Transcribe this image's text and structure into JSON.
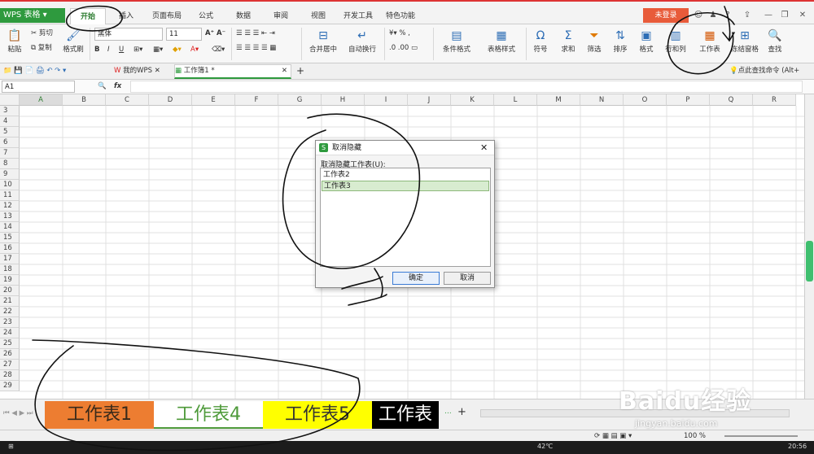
{
  "app": {
    "brand": "WPS 表格",
    "login_label": "未登录"
  },
  "tabs": [
    "开始",
    "插入",
    "页面布局",
    "公式",
    "数据",
    "审阅",
    "视图",
    "开发工具",
    "特色功能"
  ],
  "ribbon": {
    "paste": "粘贴",
    "cut": "剪切",
    "copy": "复制",
    "format_painter": "格式刷",
    "font_name": "黑体",
    "font_size": "11",
    "merge_center": "合并居中",
    "wrap_text": "自动换行",
    "percent": "%",
    "cond_format": "条件格式",
    "table_style": "表格样式",
    "symbol": "符号",
    "sum": "求和",
    "filter": "筛选",
    "sort": "排序",
    "format": "格式",
    "row_col": "行和列",
    "worksheet": "工作表",
    "freeze": "冻结窗格",
    "find": "查找"
  },
  "doc_tabs": [
    "我的WPS",
    "工作簿1 *"
  ],
  "search_command": "点此查找命令 (Alt+",
  "formula_bar": {
    "cell_ref": "A1",
    "fx": "fx"
  },
  "columns": [
    "A",
    "B",
    "C",
    "D",
    "E",
    "F",
    "G",
    "H",
    "I",
    "J",
    "K",
    "L",
    "M",
    "N",
    "O",
    "P",
    "Q",
    "R"
  ],
  "rows": [
    "3",
    "4",
    "5",
    "6",
    "7",
    "8",
    "9",
    "10",
    "11",
    "12",
    "13",
    "14",
    "15",
    "16",
    "17",
    "18",
    "19",
    "20",
    "21",
    "22",
    "23",
    "24",
    "25",
    "26",
    "27",
    "28",
    "29"
  ],
  "dialog": {
    "title": "取消隐藏",
    "list_label": "取消隐藏工作表(U):",
    "items": [
      "工作表2",
      "工作表3"
    ],
    "selected_item": "工作表3",
    "ok": "确定",
    "cancel": "取消"
  },
  "sheets": [
    {
      "name": "工作表1",
      "bg": "#ed7d31",
      "fg": "#3a2a1a"
    },
    {
      "name": "工作表4",
      "bg": "#ffffff",
      "fg": "#4e9a3a"
    },
    {
      "name": "工作表5",
      "bg": "#ffff00",
      "fg": "#333333"
    },
    {
      "name": "工作表",
      "bg": "#000000",
      "fg": "#ffffff"
    }
  ],
  "status": {
    "zoom": "100 %"
  },
  "taskbar": {
    "temp": "42℃",
    "time": "20:56"
  },
  "watermark": {
    "logo": "Baidu经验",
    "url": "jingyan.baidu.com"
  },
  "colors": {
    "accent": "#2e9a3e",
    "login": "#e85b3a",
    "dialog_select": "#d8ecd0"
  }
}
